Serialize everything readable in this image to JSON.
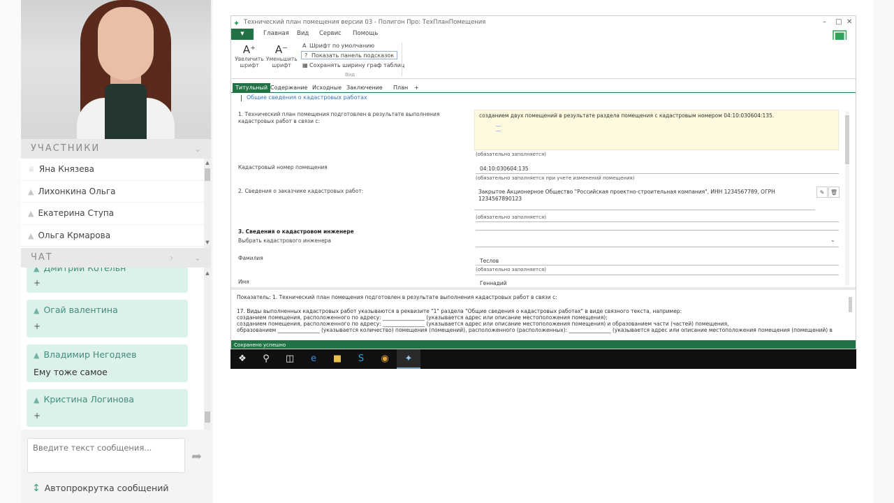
{
  "participants": {
    "header": "УЧАСТНИКИ",
    "items": [
      {
        "name": "Яна Князева",
        "icon": "crown-icon"
      },
      {
        "name": "Лихонкина Ольга",
        "icon": "graduation-cap-icon"
      },
      {
        "name": "Екатерина Ступа",
        "icon": "graduation-cap-icon"
      },
      {
        "name": "Ольга Крмарова",
        "icon": "graduation-cap-icon"
      }
    ]
  },
  "chat": {
    "header": "ЧАТ",
    "messages": [
      {
        "author": "Дмитрий Котельн",
        "text": "",
        "plus": "+"
      },
      {
        "author": "Огай валентина",
        "text": "",
        "plus": "+"
      },
      {
        "author": "Владимир Негодяев",
        "text": "Ему тоже самое",
        "plus": ""
      },
      {
        "author": "Кристина Логинова",
        "text": "",
        "plus": "+"
      }
    ],
    "input_placeholder": "Введите текст сообщения...",
    "autoscroll_label": "Автопрокрутка сообщений"
  },
  "app": {
    "window_title": "Технический план помещения версии 03 - Полигон Про: ТехПланПомещения",
    "menu": {
      "file": "▼",
      "items": [
        "Главная",
        "Вид",
        "Сервис",
        "Помощь"
      ]
    },
    "ribbon": {
      "increase_font": "Увеличить шрифт",
      "decrease_font": "Уменьшить шрифт",
      "options": [
        "Шрифт по умолчанию",
        "Показать панель подсказок",
        "Сохранять ширину граф таблиц"
      ],
      "group_label": "Вид"
    },
    "tabs": [
      "Титульный",
      "Содержание",
      "Исходные",
      "Заключение",
      "План",
      "+"
    ],
    "section_title": "Общие сведения о кадастровых работах",
    "form": {
      "field1_label": "1. Технический план помещения подготовлен в результате выполнения кадастровых работ в связи с:",
      "field1_value": "созданием двух помещений в результате раздела помещения с кадастровым номером 04:10:030604:135.",
      "field1_dash1": "—",
      "field1_dash2": "—",
      "required_hint": "(обязательно заполняется)",
      "cadnum_label": "Кадастровый номер помещения",
      "cadnum_value": "04:10:030604:135",
      "cadnum_hint": "(обязательно заполняется при учете изменений помещения)",
      "customer_label": "2. Сведения о заказчике кадастровых работ:",
      "customer_value": "Закрытое Акционерное Общество \"Российская проектно-строительная компания\", ИНН 1234567789, ОГРН 1234567890123",
      "customer_hint": "(обязательно заполняется)",
      "engineer_section": "3. Сведения о кадастровом инженере",
      "choose_engineer": "Выбрать кадастрового инженера",
      "surname_label": "Фамилия",
      "surname_value": "Теслов",
      "surname_hint": "(обязательно заполняется)",
      "name_label": "Имя",
      "name_value": "Геннадий"
    },
    "hints": {
      "line1": "Показатель: 1. Технический план помещения подготовлен в результате выполнения кадастровых работ в связи с:",
      "line2": "17. Виды выполненных кадастровых работ указываются в реквизите \"1\" раздела \"Общие сведения о кадастровых работах\" в виде связного текста, например:",
      "line3": "созданием помещения, расположенного по адресу: ________________ (указывается адрес или описание местоположения помещения);",
      "line4": "созданием помещения, расположенного по адресу: ________________ (указывается адрес или описание местоположения помещения) и образованием части (частей) помещения,",
      "line5": "образованием ________________ (указывается количество) помещения (помещений), расположенного (расположенных): ________________ (указывается адрес или описание местоположения помещения (помещений) в"
    },
    "status": "Сохранено успешно"
  },
  "colors": {
    "accent": "#217346",
    "chat_bubble": "#dcf1ea",
    "chat_author": "#3f8d7a",
    "hint_yellow": "#fcf9de"
  }
}
